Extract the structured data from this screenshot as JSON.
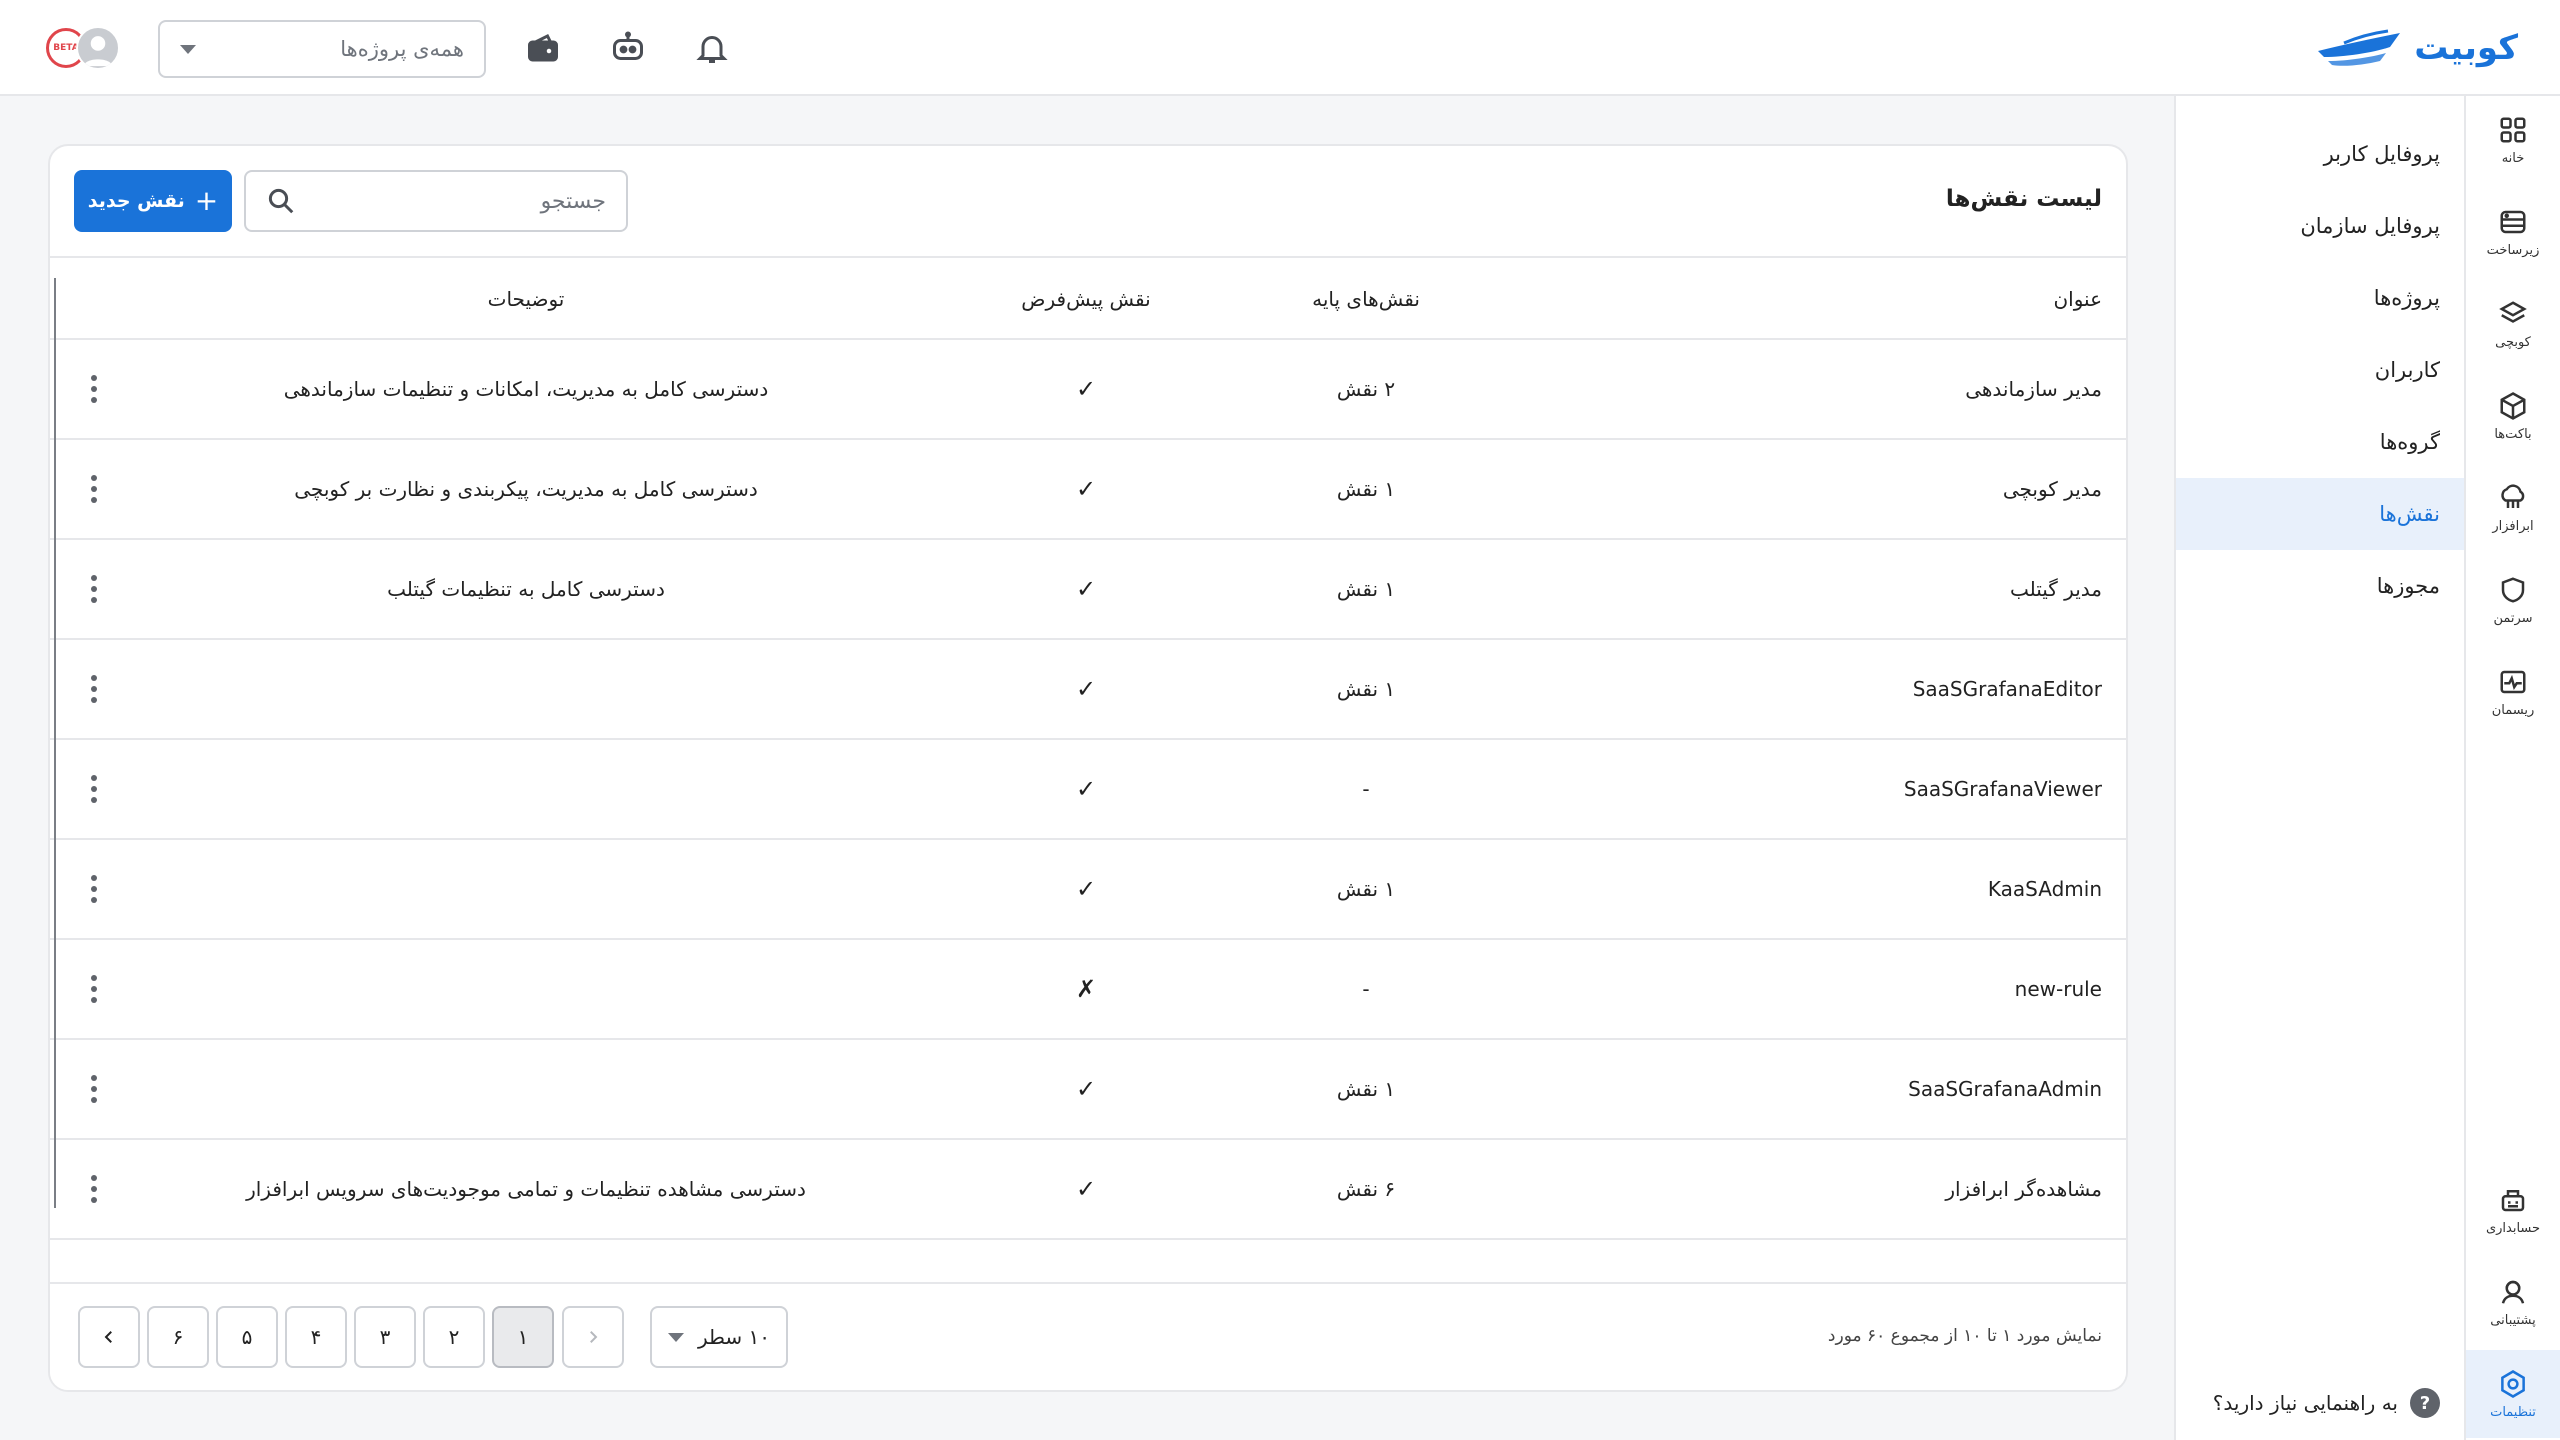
{
  "brand": {
    "name": "کوبیت",
    "color": "#1a73d9"
  },
  "topbar": {
    "project_placeholder": "همه‌ی پروژه‌ها",
    "icons": [
      "bell-icon",
      "bot-icon",
      "wallet-icon"
    ],
    "avatar_badge": "BETA"
  },
  "rail": {
    "items": [
      {
        "label": "خانه",
        "icon": "grid-icon"
      },
      {
        "label": "زیرساخت",
        "icon": "server-icon"
      },
      {
        "label": "کوبچی",
        "icon": "layers-icon"
      },
      {
        "label": "باکت‌ها",
        "icon": "cube-icon"
      },
      {
        "label": "ابرافزار",
        "icon": "cloud-app-icon"
      },
      {
        "label": "سرتمن",
        "icon": "shield-icon"
      },
      {
        "label": "ریسمان",
        "icon": "pulse-icon"
      }
    ],
    "bottom_items": [
      {
        "label": "حسابداری",
        "icon": "billing-icon"
      },
      {
        "label": "پشتیبانی",
        "icon": "support-icon"
      },
      {
        "label": "تنظیمات",
        "icon": "settings-icon",
        "active": true
      }
    ]
  },
  "submenu": {
    "items": [
      {
        "label": "پروفایل کاربر"
      },
      {
        "label": "پروفایل سازمان"
      },
      {
        "label": "پروژه‌ها"
      },
      {
        "label": "کاربران"
      },
      {
        "label": "گروه‌ها"
      },
      {
        "label": "نقش‌ها",
        "active": true
      },
      {
        "label": "مجوزها"
      }
    ],
    "help": "به راهنمایی نیاز دارید؟"
  },
  "main": {
    "title": "لیست نقش‌ها",
    "new_button": "نقش جدید",
    "search_placeholder": "جستجو",
    "columns": {
      "title": "عنوان",
      "base_roles": "نقش‌های پایه",
      "default_role": "نقش پیش‌فرض",
      "description": "توضیحات"
    },
    "rows": [
      {
        "title": "مدیر سازماندهی",
        "base": "۲ نقش",
        "default": "✓",
        "desc": "دسترسی کامل به مدیریت، امکانات و تنظیمات سازماندهی"
      },
      {
        "title": "مدیر کوبچی",
        "base": "۱ نقش",
        "default": "✓",
        "desc": "دسترسی کامل به مدیریت، پیکربندی و نظارت بر کوبچی"
      },
      {
        "title": "مدیر گیتلب",
        "base": "۱ نقش",
        "default": "✓",
        "desc": "دسترسی کامل به تنظیمات گیتلب"
      },
      {
        "title": "SaaSGrafanaEditor",
        "base": "۱ نقش",
        "default": "✓",
        "desc": ""
      },
      {
        "title": "SaaSGrafanaViewer",
        "base": "-",
        "default": "✓",
        "desc": ""
      },
      {
        "title": "KaaSAdmin",
        "base": "۱ نقش",
        "default": "✓",
        "desc": ""
      },
      {
        "title": "new-rule",
        "base": "-",
        "default": "✗",
        "desc": ""
      },
      {
        "title": "SaaSGrafanaAdmin",
        "base": "۱ نقش",
        "default": "✓",
        "desc": ""
      },
      {
        "title": "مشاهده‌گر ابرافزار",
        "base": "۶ نقش",
        "default": "✓",
        "desc": "دسترسی مشاهده تنظیمات و تمامی موجودیت‌های سرویس ابرافزار"
      }
    ],
    "footer": {
      "summary": "نمایش مورد ۱ تا ۱۰ از مجموع ۶۰ مورد",
      "rows_per_page": "۱۰ سطر",
      "pages": [
        "۱",
        "۲",
        "۳",
        "۴",
        "۵",
        "۶"
      ],
      "current_page": "۱"
    }
  }
}
